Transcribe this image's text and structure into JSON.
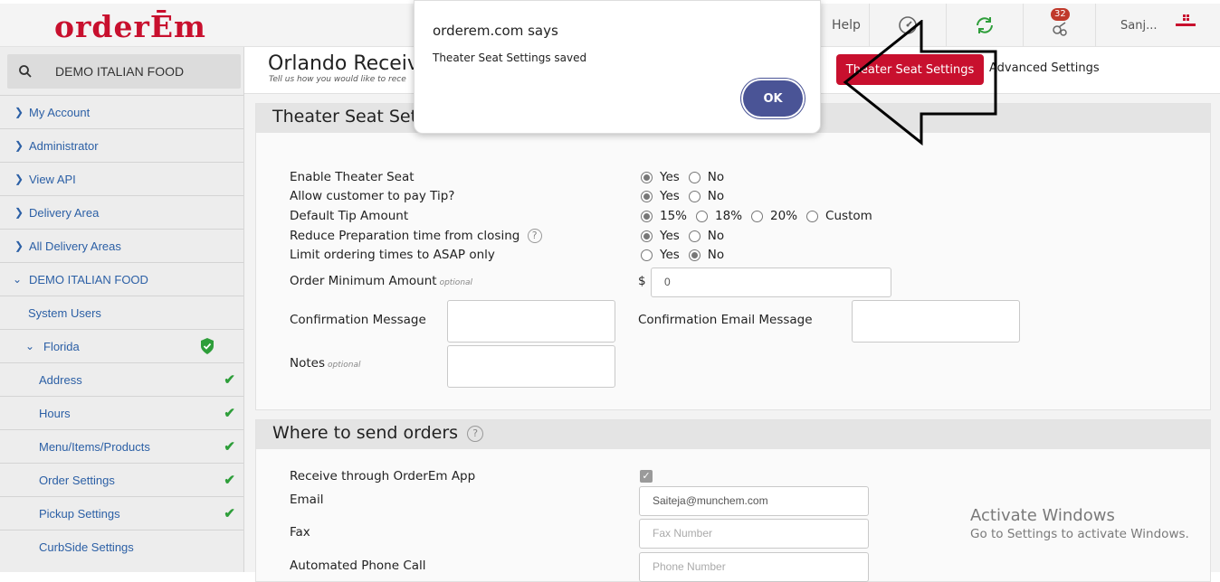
{
  "topbar": {
    "logo": "orderĒm",
    "help_label": "Help",
    "notification_count": "32",
    "user_label": "Sanj..."
  },
  "sidebar": {
    "search_value": "DEMO ITALIAN FOOD",
    "items": [
      {
        "label": "My Account"
      },
      {
        "label": "Administrator"
      },
      {
        "label": "View API"
      },
      {
        "label": "Delivery Area"
      },
      {
        "label": "All Delivery Areas"
      },
      {
        "label": "DEMO ITALIAN FOOD"
      },
      {
        "label": "System Users"
      },
      {
        "label": "Florida"
      },
      {
        "label": "Address"
      },
      {
        "label": "Hours"
      },
      {
        "label": "Menu/Items/Products"
      },
      {
        "label": "Order Settings"
      },
      {
        "label": "Pickup Settings"
      },
      {
        "label": "CurbSide Settings"
      }
    ]
  },
  "header": {
    "title": "Orlando Receiv",
    "subtitle": "Tell us how you would like to rece",
    "active_button": "Theater Seat Settings",
    "advanced_link": "Advanced Settings"
  },
  "theater": {
    "title": "Theater Seat Set",
    "enable_label": "Enable Theater Seat",
    "tip_label": "Allow customer to pay Tip?",
    "default_tip_label": "Default Tip Amount",
    "reduce_label": "Reduce Preparation time from closing",
    "limit_label": "Limit ordering times to ASAP only",
    "min_label": "Order Minimum Amount",
    "optional": "optional",
    "currency": "$",
    "min_value": "0",
    "confirm_label": "Confirmation Message",
    "confirm_email_label": "Confirmation Email Message",
    "notes_label": "Notes",
    "yes": "Yes",
    "no": "No",
    "tip_15": "15%",
    "tip_18": "18%",
    "tip_20": "20%",
    "tip_custom": "Custom",
    "help_mark": "?"
  },
  "orders": {
    "title": "Where to send orders",
    "app_label": "Receive through OrderEm App",
    "email_label": "Email",
    "email_value": "Saiteja@munchem.com",
    "fax_label": "Fax",
    "fax_placeholder": "Fax Number",
    "phone_label": "Automated Phone Call",
    "phone_placeholder": "Phone Number"
  },
  "watermark": {
    "line1": "Activate Windows",
    "line2": "Go to Settings to activate Windows."
  },
  "dialog": {
    "title": "orderem.com says",
    "message": "Theater Seat Settings saved",
    "ok": "OK"
  },
  "colors": {
    "brand_red": "#c8102e",
    "ok_blue": "#4a5496",
    "link_blue": "#2b5fa5",
    "check_green": "#2e9e3a"
  }
}
